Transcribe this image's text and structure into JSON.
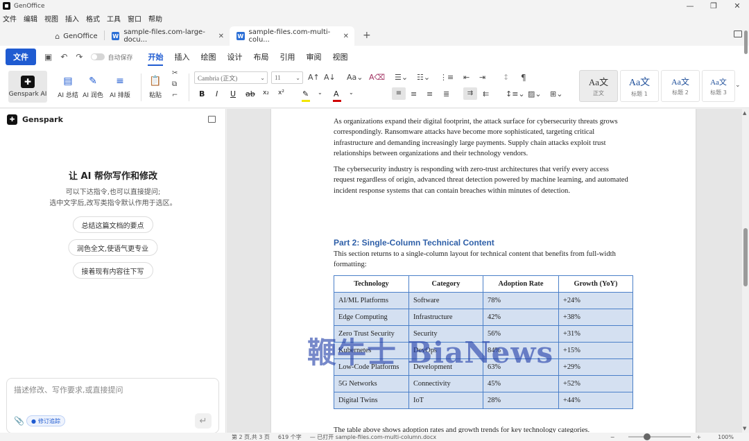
{
  "app": {
    "name": "GenOffice",
    "window_controls": [
      "—",
      "❐",
      "✕"
    ]
  },
  "menu": [
    "文件",
    "编辑",
    "视图",
    "插入",
    "格式",
    "工具",
    "窗口",
    "帮助"
  ],
  "tabs": {
    "home_label": "GenOffice",
    "docs": [
      {
        "label": "sample-files.com-large-docu...",
        "active": false
      },
      {
        "label": "sample-files.com-multi-colu...",
        "active": true
      }
    ]
  },
  "ribbon": {
    "file_label": "文件",
    "autosave_label": "自动保存",
    "tabs": [
      "开始",
      "插入",
      "绘图",
      "设计",
      "布局",
      "引用",
      "审阅",
      "视图"
    ],
    "active_tab": "开始",
    "ai_buttons": [
      "Genspark AI",
      "AI 总结",
      "AI 润色",
      "AI 排版"
    ],
    "paste_label": "粘贴",
    "font_name": "Cambria (正文)",
    "font_size": "11",
    "styles": [
      {
        "sample": "Aa文",
        "name": "正文"
      },
      {
        "sample": "Aa文",
        "name": "标题 1"
      },
      {
        "sample": "Aa文",
        "name": "标题 2"
      },
      {
        "sample": "Aa文",
        "name": "标题 3"
      }
    ],
    "highlight_color": "#f2e600",
    "font_color": "#d00000"
  },
  "panel": {
    "title": "Genspark",
    "heading": "让 AI 帮你写作和修改",
    "sub1": "可以下达指令,也可以直接提问;",
    "sub2": "选中文字后,改写类指令默认作用于选区。",
    "suggestions": [
      "总结这篇文档的要点",
      "润色全文,使语气更专业",
      "接着现有内容往下写"
    ],
    "input_placeholder": "描述修改、写作要求,或直接提问",
    "track_label": "修订追踪"
  },
  "document": {
    "para1": "As organizations expand their digital footprint, the attack surface for cybersecurity threats grows correspondingly. Ransomware attacks have become more sophisticated, targeting critical infrastructure and demanding increasingly large payments. Supply chain attacks exploit trust relationships between organizations and their technology vendors.",
    "para2": "The cybersecurity industry is responding with zero-trust architectures that verify every access request regardless of origin, advanced threat detection powered by machine learning, and automated incident response systems that can contain breaches within minutes of detection.",
    "heading": "Part 2: Single-Column Technical Content",
    "para3": "This section returns to a single-column layout for technical content that benefits from full-width formatting:",
    "table": {
      "headers": [
        "Technology",
        "Category",
        "Adoption Rate",
        "Growth (YoY)"
      ],
      "rows": [
        [
          "AI/ML Platforms",
          "Software",
          "78%",
          "+24%"
        ],
        [
          "Edge Computing",
          "Infrastructure",
          "42%",
          "+38%"
        ],
        [
          "Zero Trust Security",
          "Security",
          "56%",
          "+31%"
        ],
        [
          "Kubernetes",
          "DevOps",
          "84%",
          "+15%"
        ],
        [
          "Low-Code Platforms",
          "Development",
          "63%",
          "+29%"
        ],
        [
          "5G Networks",
          "Connectivity",
          "45%",
          "+52%"
        ],
        [
          "Digital Twins",
          "IoT",
          "28%",
          "+44%"
        ]
      ]
    },
    "tail": "The table above shows adoption rates and growth trends for key technology categories.",
    "watermark": "鞭牛士 BiaNews"
  },
  "status": {
    "page": "第 2 页,共 3 页",
    "words": "619 个字",
    "opened": "— 已打开 sample-files.com-multi-column.docx",
    "zoom": "100%",
    "zoom_level": 0.3
  }
}
